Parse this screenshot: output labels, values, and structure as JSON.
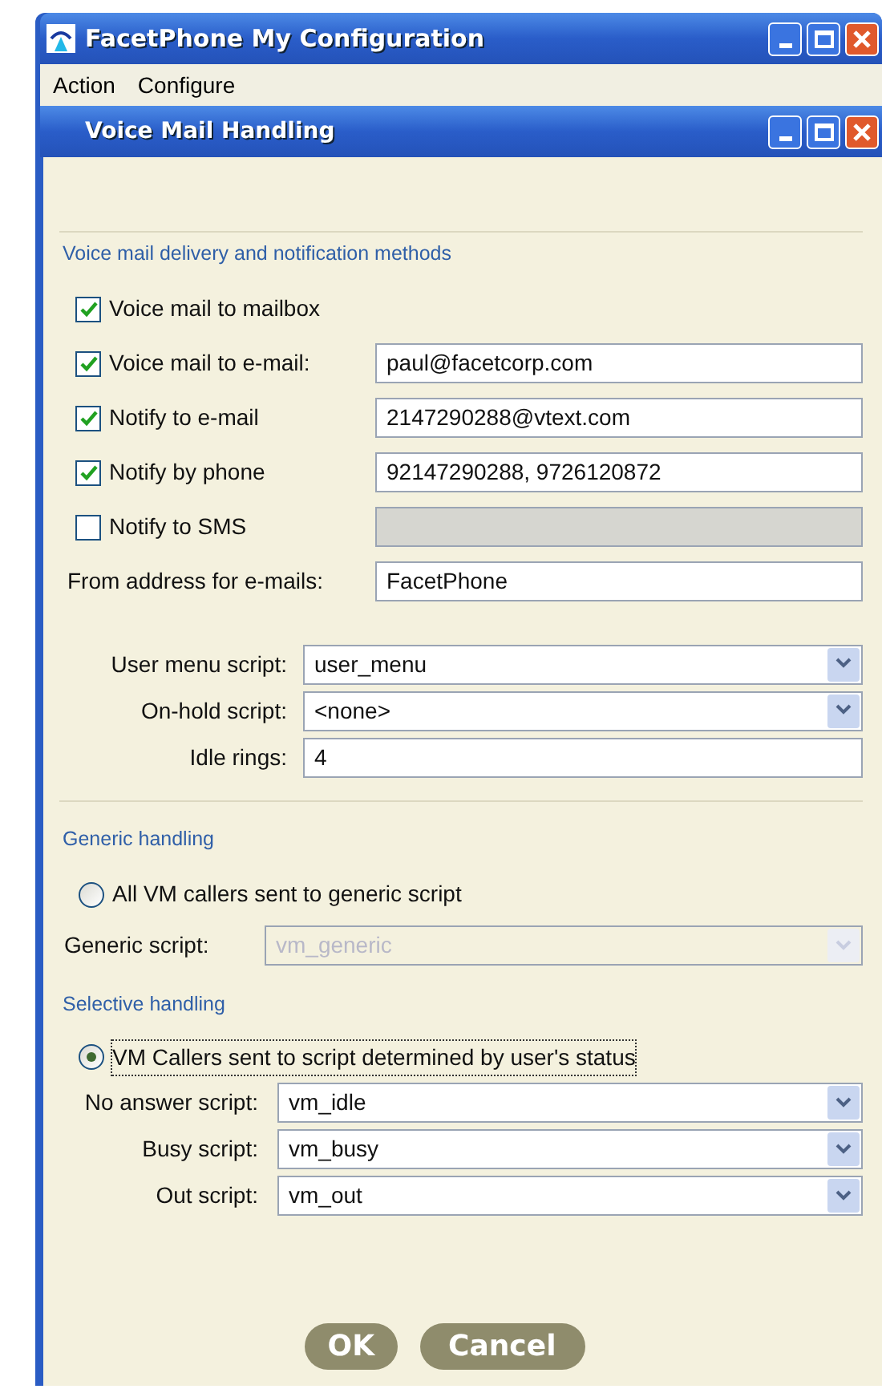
{
  "window": {
    "title": "FacetPhone My Configuration"
  },
  "menu": [
    {
      "label": "Action"
    },
    {
      "label": "Configure"
    }
  ],
  "dialog": {
    "title": "Voice Mail Handling"
  },
  "delivery": {
    "heading": "Voice mail delivery and notification methods",
    "rows": [
      {
        "kind": "checkbox",
        "label": "Voice mail to mailbox",
        "checked": true
      },
      {
        "kind": "checkbox",
        "label": "Voice mail to e-mail:",
        "checked": true,
        "value": "paul@facetcorp.com",
        "disabled": false
      },
      {
        "kind": "checkbox",
        "label": "Notify to e-mail",
        "checked": true,
        "value": "2147290288@vtext.com",
        "disabled": false
      },
      {
        "kind": "checkbox",
        "label": "Notify by phone",
        "checked": true,
        "value": "92147290288, 9726120872",
        "disabled": false
      },
      {
        "kind": "checkbox",
        "label": "Notify to SMS",
        "checked": false,
        "disabled": true
      },
      {
        "kind": "field",
        "label": "From address for e-mails:",
        "value": "FacetPhone",
        "disabled": false
      }
    ]
  },
  "scripts": [
    {
      "kind": "dropdown",
      "label": "User menu script:",
      "value": "user_menu"
    },
    {
      "kind": "dropdown",
      "label": "On-hold script:",
      "value": "<none>"
    },
    {
      "kind": "field",
      "label": "Idle rings:",
      "value": "4"
    }
  ],
  "generic": {
    "heading": "Generic handling",
    "option": {
      "label": "All VM callers sent to generic script",
      "selected": false
    },
    "script": {
      "label": "Generic script:",
      "value": "vm_generic",
      "disabled": true
    }
  },
  "selective": {
    "heading": "Selective handling",
    "option": {
      "label": "VM Callers sent to script determined by user's status",
      "selected": true
    },
    "rows": [
      {
        "label": "No answer script:",
        "value": "vm_idle"
      },
      {
        "label": "Busy script:",
        "value": "vm_busy"
      },
      {
        "label": "Out script:",
        "value": "vm_out"
      }
    ]
  },
  "buttons": [
    {
      "label": "OK"
    },
    {
      "label": "Cancel"
    }
  ]
}
